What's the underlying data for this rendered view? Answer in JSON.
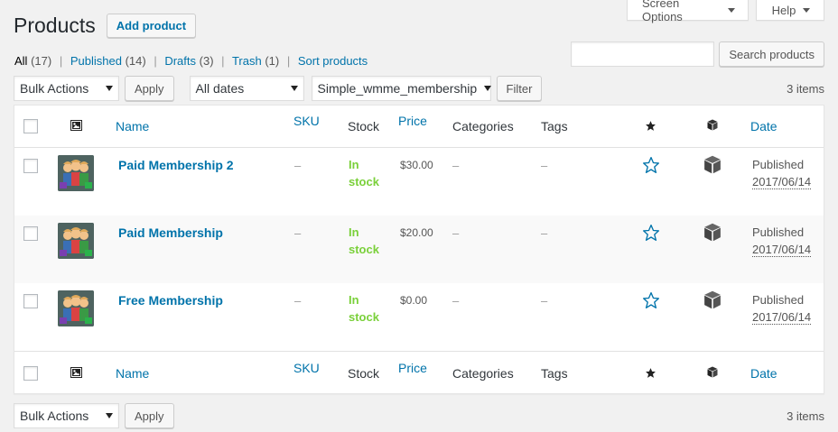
{
  "header": {
    "screen_options": "Screen Options",
    "help": "Help",
    "title": "Products",
    "add_button": "Add product"
  },
  "filters": [
    {
      "label": "All",
      "count": "(17)"
    },
    {
      "label": "Published",
      "count": "(14)"
    },
    {
      "label": "Drafts",
      "count": "(3)"
    },
    {
      "label": "Trash",
      "count": "(1)"
    },
    {
      "label": "Sort products",
      "count": ""
    }
  ],
  "search": {
    "placeholder": "",
    "button": "Search products"
  },
  "tablenav": {
    "bulk_action": "Bulk Actions",
    "apply": "Apply",
    "dates": "All dates",
    "product_type": "Simple_wmme_membership",
    "filter": "Filter",
    "items_count": "3 items"
  },
  "columns": {
    "name": "Name",
    "sku": "SKU",
    "stock": "Stock",
    "price": "Price",
    "categories": "Categories",
    "tags": "Tags",
    "date": "Date"
  },
  "icons": {
    "thumbnail_column": "image-icon",
    "featured_column": "star-filled-icon",
    "type_column": "cube-icon"
  },
  "products": [
    {
      "name": "Paid Membership 2",
      "sku": "–",
      "stock": "In stock",
      "price": "$30.00",
      "categories": "–",
      "tags": "–",
      "status": "Published",
      "date": "2017/06/14"
    },
    {
      "name": "Paid Membership",
      "sku": "–",
      "stock": "In stock",
      "price": "$20.00",
      "categories": "–",
      "tags": "–",
      "status": "Published",
      "date": "2017/06/14"
    },
    {
      "name": "Free Membership",
      "sku": "–",
      "stock": "In stock",
      "price": "$0.00",
      "categories": "–",
      "tags": "–",
      "status": "Published",
      "date": "2017/06/14"
    }
  ],
  "colors": {
    "link": "#0073aa",
    "in_stock": "#7ad03a",
    "background": "#f1f1f1"
  }
}
